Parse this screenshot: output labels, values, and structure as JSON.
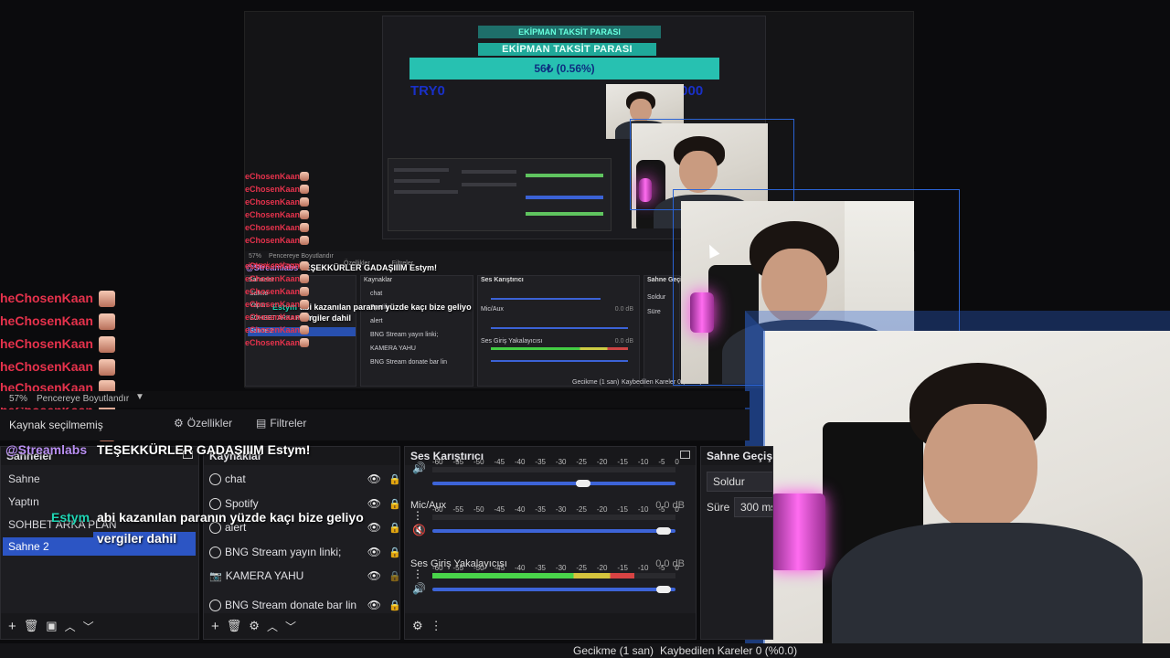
{
  "preview": {
    "goal_small": "EKİPMAN TAKSİT PARASI",
    "goal_title": "EKİPMAN TAKSİT PARASI",
    "goal_bar": "56₺ (0.56%)",
    "goal_min": "TRY0",
    "goal_max": "TRY10000",
    "mid_tabs": [
      "Özellikler",
      "Filtreler"
    ],
    "mid_zoom": "57%",
    "mid_zoom_label": "Pencereye Boyutlandır",
    "mid_source_hint": "Kaynak seçilmemiş",
    "mid_scenes": [
      "Sahne",
      "Yaptın",
      "SOHBET ARKA PLAN",
      "Sahne 2"
    ],
    "mid_sources": [
      "chat",
      "Spotify",
      "alert",
      "BNG Stream yayın linki;",
      "KAMERA YAHU",
      "BNG Stream donate bar lin"
    ],
    "mid_mixer_title": "Ses Karıştırıcı",
    "mid_mic": "Mic/Aux",
    "mid_capture": "Ses Giriş Yakalayıcısı",
    "mid_db": "0.0 dB",
    "mid_trans_title": "Sahne Geçişi",
    "mid_trans_value": "Soldur",
    "mid_trans_dur": "Süre",
    "mid_trans_dur_value": "300 ms",
    "mid_status_delay": "Gecikme (1 san)",
    "mid_status_frames": "Kaybedilen Kareler 0 (%0.0)",
    "mid_scenes_title": "Sahneler",
    "mid_sources_title": "Kaynaklar",
    "mid_overlay_user": "@Streamlabs",
    "mid_overlay_title": "TEŞEKKÜRLER GADAŞIIIM Estym!",
    "mid_overlay_name": "Estym",
    "mid_overlay_msg1": "abi kazanılan paranın yüzde kaçı bize geliyo",
    "mid_overlay_msg2": "vergiler dahil"
  },
  "chat": {
    "username": "TheChosenKaan",
    "username_truncated": "eChosenKaan",
    "username_cut": "heChosenKaan",
    "small_lines": 12,
    "big_lines": 11
  },
  "toolbar": {
    "zoom": "57%",
    "zoom_label": "Pencereye Boyutlandır",
    "source_hint": "Kaynak seçilmemiş",
    "properties": "Özellikler",
    "filters": "Filtreler"
  },
  "overlay": {
    "user": "@Streamlabs",
    "title": "TEŞEKKÜRLER GADAŞIIIM Estym!",
    "donor": "Estym",
    "message_line1": "abi kazanılan paranın yüzde kaçı bize geliyo",
    "message_line2": "vergiler dahil"
  },
  "scenes": {
    "title": "Sahneler",
    "items": [
      "Sahne",
      "Yaptın",
      "SOHBET ARKA PLAN",
      "Sahne 2"
    ],
    "selected": "Sahne 2"
  },
  "sources": {
    "title": "Kaynaklar",
    "items": [
      "chat",
      "Spotify",
      "alert",
      "BNG Stream yayın linki;",
      "KAMERA YAHU",
      "BNG Stream donate bar lin"
    ]
  },
  "mixer": {
    "title": "Ses Karıştırıcı",
    "scale": [
      "-60",
      "-55",
      "-50",
      "-45",
      "-40",
      "-35",
      "-30",
      "-25",
      "-20",
      "-15",
      "-10",
      "-5",
      "0"
    ],
    "channels": [
      {
        "name": "",
        "db": "",
        "level": 0.0,
        "volume": 0.65
      },
      {
        "name": "Mic/Aux",
        "db": "0.0 dB",
        "level": 0.0,
        "volume": 0.98
      },
      {
        "name": "Ses Giriş Yakalayıcısı",
        "db": "0.0 dB",
        "level": 0.83,
        "volume": 0.98
      }
    ]
  },
  "transition": {
    "title": "Sahne Geçişi",
    "value": "Soldur",
    "duration_label": "Süre",
    "duration_value": "300 ms"
  },
  "status": {
    "delay": "Gecikme (1 san)",
    "frames": "Kaybedilen Kareler 0 (%0.0)"
  },
  "colors": {
    "accent": "#2c55c4",
    "goal": "#27c1b1",
    "chat": "#e6324c",
    "donor": "#1fd5b4",
    "streamlabs": "#b98ff2"
  }
}
